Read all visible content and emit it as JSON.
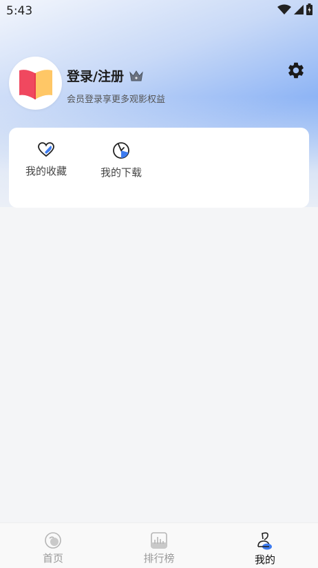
{
  "status_bar": {
    "time": "5:43"
  },
  "profile": {
    "title": "登录/注册",
    "subtitle": "会员登录享更多观影权益"
  },
  "quick_actions": [
    {
      "label": "我的收藏",
      "icon": "heart-icon"
    },
    {
      "label": "我的下载",
      "icon": "download-icon"
    }
  ],
  "bottom_nav": [
    {
      "label": "首页",
      "icon": "home-icon",
      "active": false
    },
    {
      "label": "排行榜",
      "icon": "ranking-icon",
      "active": false
    },
    {
      "label": "我的",
      "icon": "profile-icon",
      "active": true
    }
  ],
  "colors": {
    "accent": "#3d7cf0",
    "book_red": "#f0485f",
    "book_yellow": "#ffc766"
  }
}
